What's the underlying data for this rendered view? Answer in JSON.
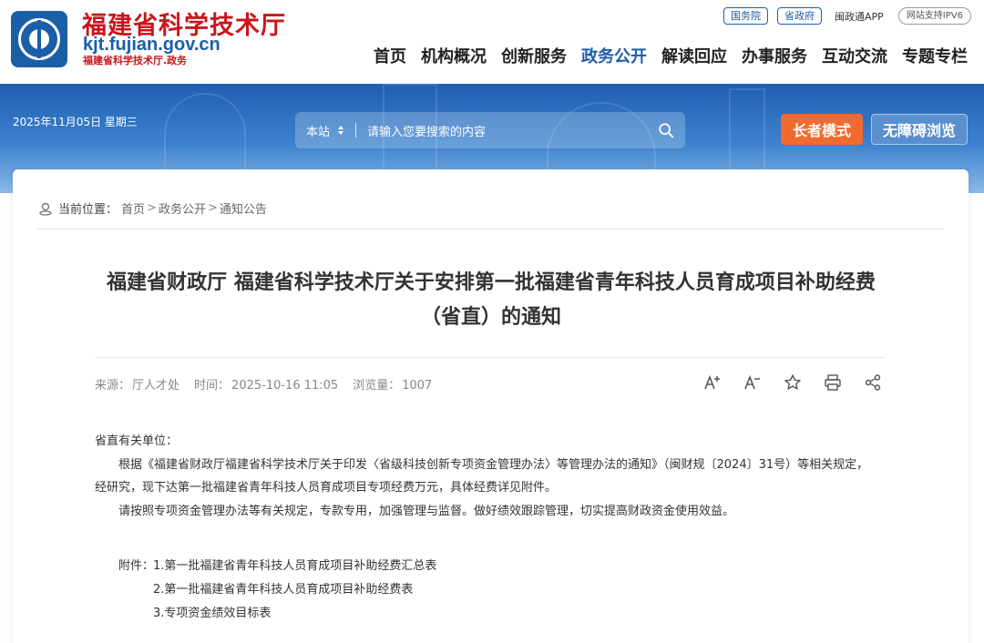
{
  "header": {
    "title": "福建省科学技术厅",
    "domain": "kjt.fujian.gov.cn",
    "subtitle": "福建省科学技术厅.政务",
    "top_links": [
      "国务院",
      "省政府"
    ],
    "app_link": "闽政通APP",
    "ipv6": "网站支持IPV6"
  },
  "nav": [
    {
      "label": "首页",
      "active": false
    },
    {
      "label": "机构概况",
      "active": false
    },
    {
      "label": "创新服务",
      "active": false
    },
    {
      "label": "政务公开",
      "active": true
    },
    {
      "label": "解读回应",
      "active": false
    },
    {
      "label": "办事服务",
      "active": false
    },
    {
      "label": "互动交流",
      "active": false
    },
    {
      "label": "专题专栏",
      "active": false
    }
  ],
  "banner": {
    "date": "2025年11月05日 星期三",
    "search_scope": "本站",
    "search_placeholder": "请输入您要搜索的内容",
    "elder_mode": "长者模式",
    "accessible": "无障碍浏览"
  },
  "breadcrumb": {
    "label": "当前位置：",
    "items": [
      "首页",
      "政务公开",
      "通知公告"
    ]
  },
  "article": {
    "title_line1": "福建省财政厅 福建省科学技术厅关于安排第一批福建省青年科技人员育成项目补助经费",
    "title_line2": "（省直）的通知",
    "source_label": "来源：",
    "source": "厅人才处",
    "time_label": "时间：",
    "time": "2025-10-16 11:05",
    "views_label": "浏览量：",
    "views": "1007",
    "salutation": "省直有关单位：",
    "para1": "根据《福建省财政厅福建省科学技术厅关于印发〈省级科技创新专项资金管理办法〉等管理办法的通知》（闽财规〔2024〕31号）等相关规定，经研究，现下达第一批福建省青年科技人员育成项目专项经费万元，具体经费详见附件。",
    "para2": "请按照专项资金管理办法等有关规定，专款专用，加强管理与监督。做好绩效跟踪管理，切实提高财政资金使用效益。",
    "attach_head": "附件：",
    "attachments": [
      "1.第一批福建省青年科技人员育成项目补助经费汇总表",
      "2.第一批福建省青年科技人员育成项目补助经费表",
      "3.专项资金绩效目标表"
    ]
  },
  "tools": [
    "font-increase-icon",
    "font-decrease-icon",
    "star-icon",
    "print-icon",
    "share-icon"
  ],
  "colors": {
    "brand_red": "#c8161d",
    "brand_blue": "#1b5ea8",
    "elder_orange": "#f26a2e"
  }
}
